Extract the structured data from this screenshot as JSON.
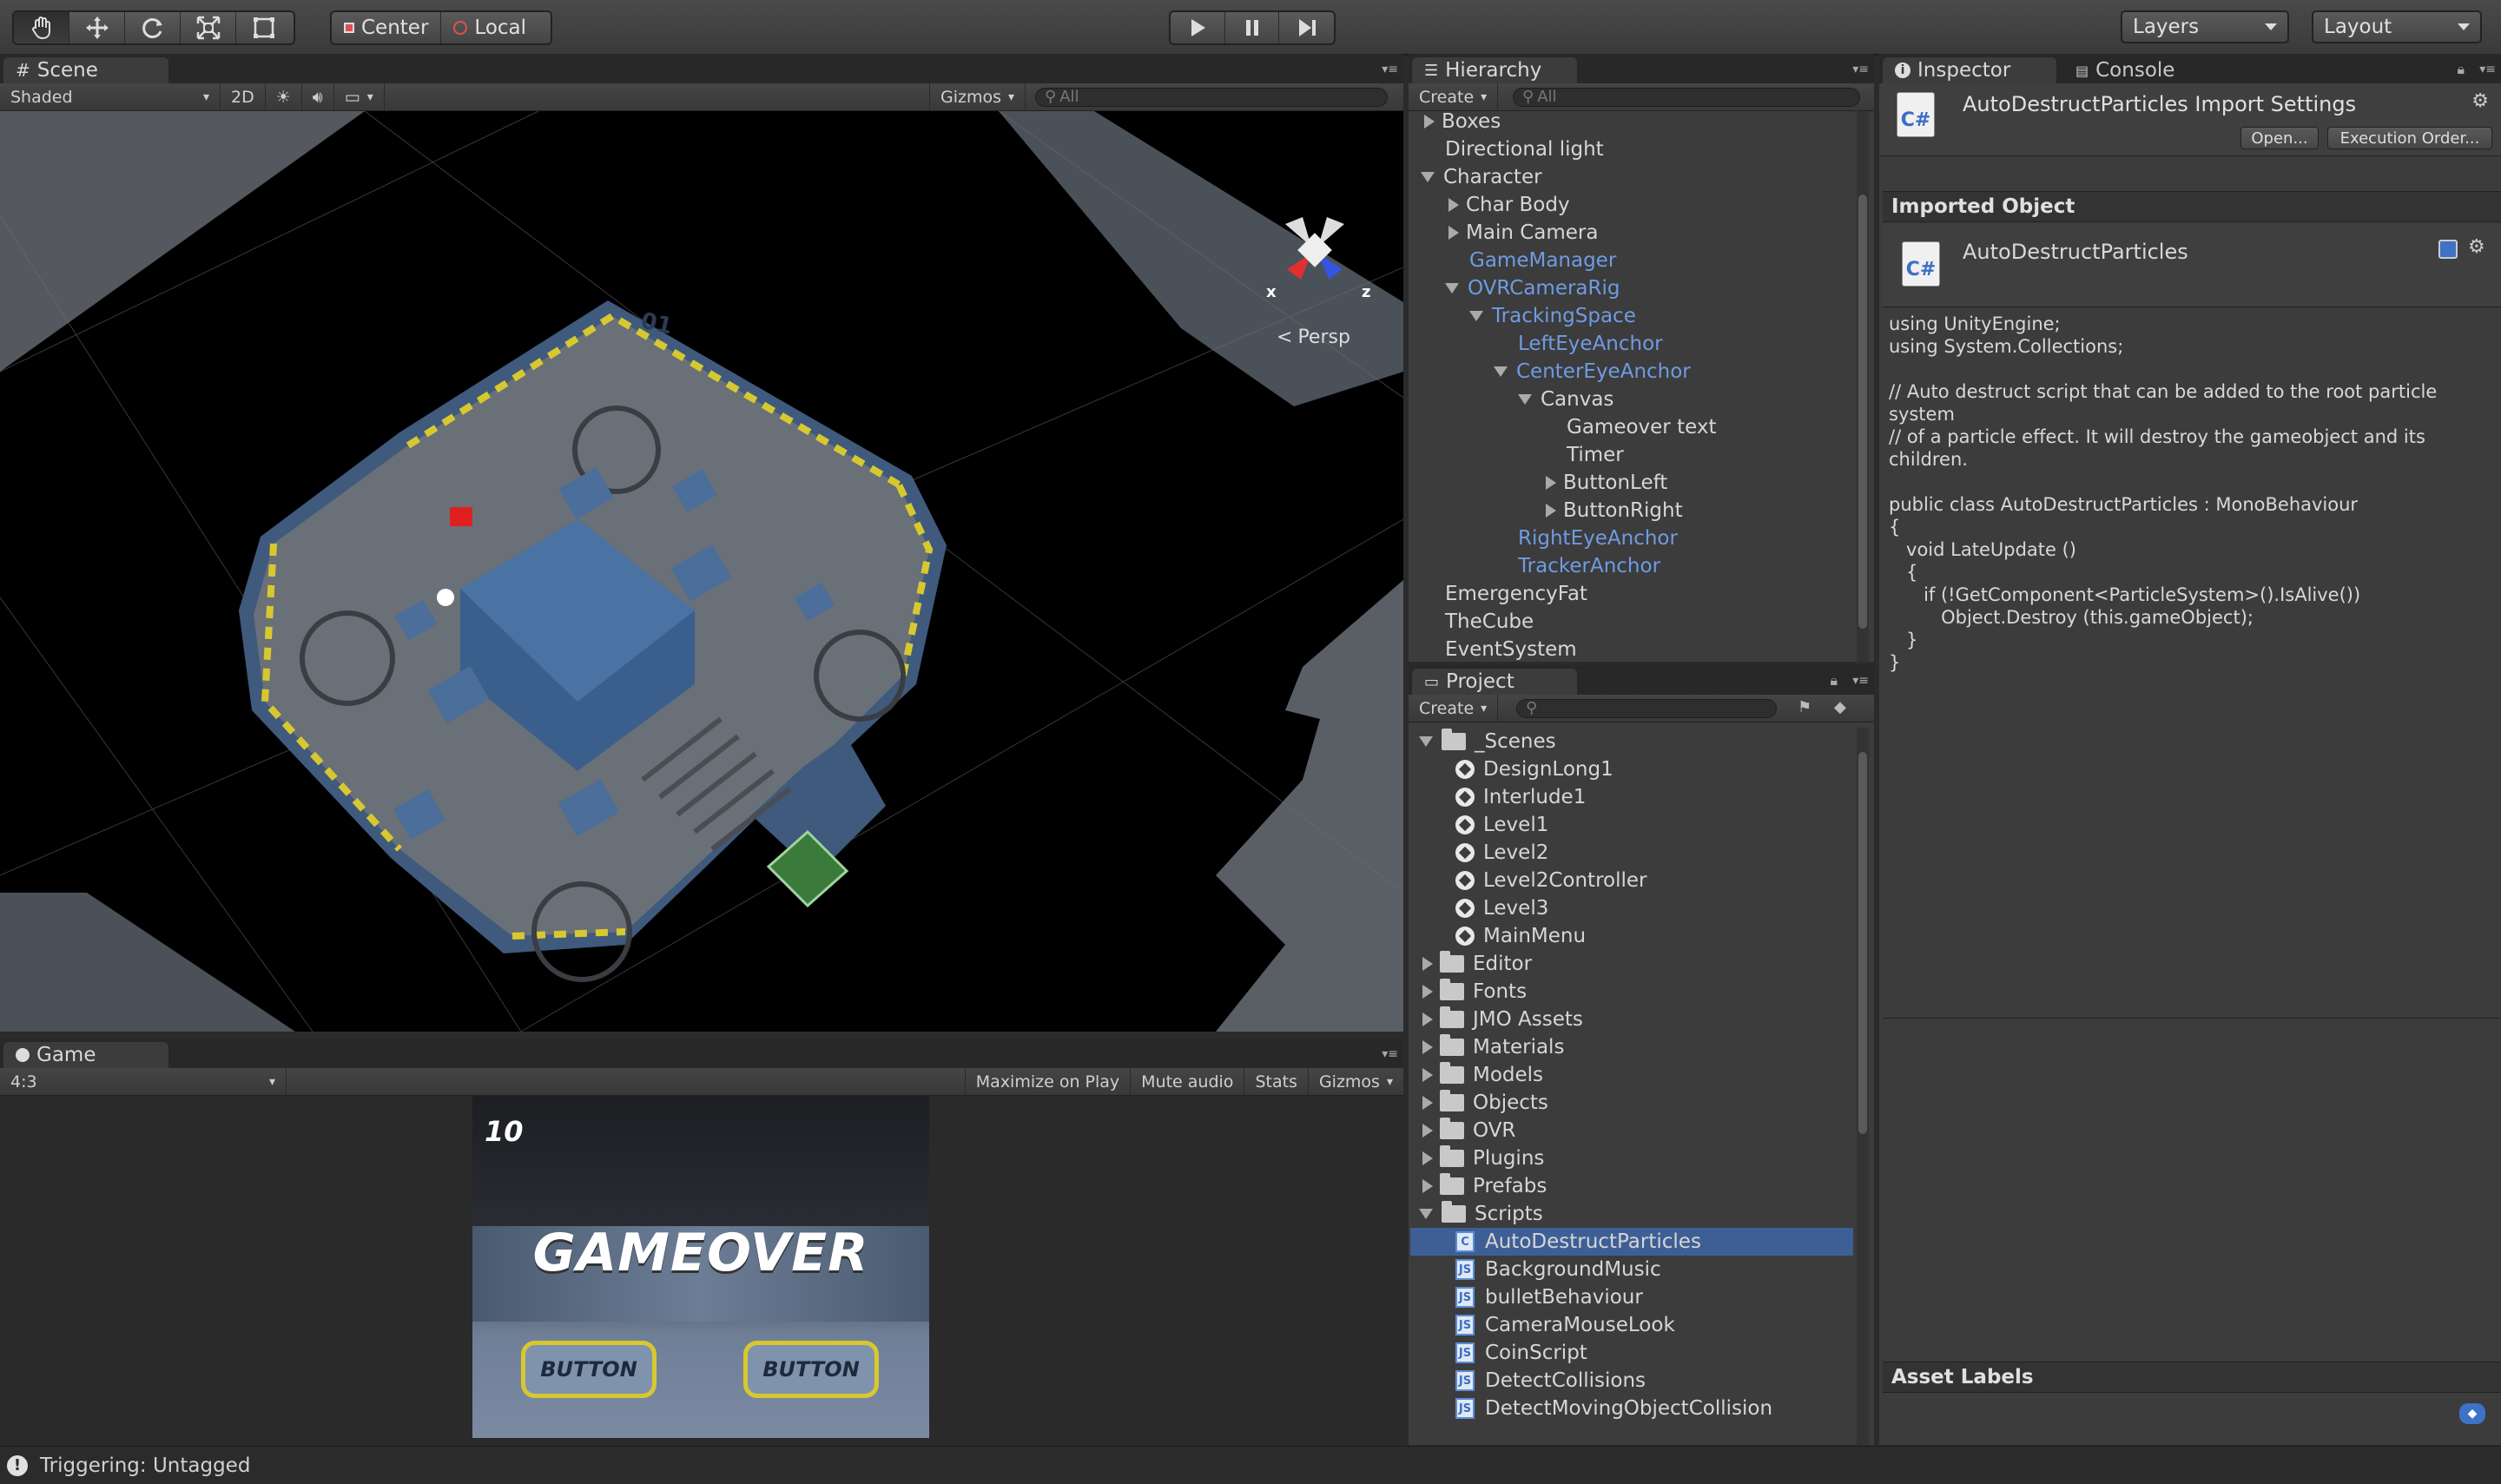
{
  "toolbar": {
    "pivot_center": "Center",
    "pivot_local": "Local",
    "layers_label": "Layers",
    "layout_label": "Layout"
  },
  "scene": {
    "tab_label": "Scene",
    "shading_mode": "Shaded",
    "mode_2d": "2D",
    "gizmos_label": "Gizmos",
    "search_placeholder": "All",
    "gizmo_x": "x",
    "gizmo_z": "z",
    "projection_label": "Persp",
    "room_number": "01"
  },
  "game": {
    "tab_label": "Game",
    "aspect": "4:3",
    "maximize_label": "Maximize on Play",
    "mute_label": "Mute audio",
    "stats_label": "Stats",
    "gizmos_label": "Gizmos",
    "timer_value": "10",
    "gameover_text": "GAMEOVER",
    "button_left": "BUTTON",
    "button_right": "BUTTON"
  },
  "hierarchy": {
    "tab_label": "Hierarchy",
    "create_label": "Create",
    "search_placeholder": "All",
    "items": [
      {
        "label": "Boxes",
        "indent": 0,
        "arrow": "closed",
        "blue": false
      },
      {
        "label": "Directional light",
        "indent": 0,
        "arrow": "none",
        "blue": false
      },
      {
        "label": "Character",
        "indent": 0,
        "arrow": "open",
        "blue": false
      },
      {
        "label": "Char Body",
        "indent": 1,
        "arrow": "closed",
        "blue": false
      },
      {
        "label": "Main Camera",
        "indent": 1,
        "arrow": "closed",
        "blue": false
      },
      {
        "label": "GameManager",
        "indent": 1,
        "arrow": "none",
        "blue": true
      },
      {
        "label": "OVRCameraRig",
        "indent": 1,
        "arrow": "open",
        "blue": true
      },
      {
        "label": "TrackingSpace",
        "indent": 2,
        "arrow": "open",
        "blue": true
      },
      {
        "label": "LeftEyeAnchor",
        "indent": 3,
        "arrow": "none",
        "blue": true
      },
      {
        "label": "CenterEyeAnchor",
        "indent": 3,
        "arrow": "open",
        "blue": true
      },
      {
        "label": "Canvas",
        "indent": 4,
        "arrow": "open",
        "blue": false
      },
      {
        "label": "Gameover text",
        "indent": 5,
        "arrow": "none",
        "blue": false
      },
      {
        "label": "Timer",
        "indent": 5,
        "arrow": "none",
        "blue": false
      },
      {
        "label": "ButtonLeft",
        "indent": 5,
        "arrow": "closed",
        "blue": false
      },
      {
        "label": "ButtonRight",
        "indent": 5,
        "arrow": "closed",
        "blue": false
      },
      {
        "label": "RightEyeAnchor",
        "indent": 3,
        "arrow": "none",
        "blue": true
      },
      {
        "label": "TrackerAnchor",
        "indent": 3,
        "arrow": "none",
        "blue": true
      },
      {
        "label": "EmergencyFat",
        "indent": 0,
        "arrow": "none",
        "blue": false
      },
      {
        "label": "TheCube",
        "indent": 0,
        "arrow": "none",
        "blue": false
      },
      {
        "label": "EventSystem",
        "indent": 0,
        "arrow": "none",
        "blue": false
      }
    ]
  },
  "project": {
    "tab_label": "Project",
    "create_label": "Create",
    "items": [
      {
        "label": "_Scenes",
        "indent": 0,
        "arrow": "open",
        "icon": "folder"
      },
      {
        "label": "DesignLong1",
        "indent": 1,
        "arrow": "none",
        "icon": "scene"
      },
      {
        "label": "Interlude1",
        "indent": 1,
        "arrow": "none",
        "icon": "scene"
      },
      {
        "label": "Level1",
        "indent": 1,
        "arrow": "none",
        "icon": "scene"
      },
      {
        "label": "Level2",
        "indent": 1,
        "arrow": "none",
        "icon": "scene"
      },
      {
        "label": "Level2Controller",
        "indent": 1,
        "arrow": "none",
        "icon": "scene"
      },
      {
        "label": "Level3",
        "indent": 1,
        "arrow": "none",
        "icon": "scene"
      },
      {
        "label": "MainMenu",
        "indent": 1,
        "arrow": "none",
        "icon": "scene"
      },
      {
        "label": "Editor",
        "indent": 0,
        "arrow": "closed",
        "icon": "folder"
      },
      {
        "label": "Fonts",
        "indent": 0,
        "arrow": "closed",
        "icon": "folder"
      },
      {
        "label": "JMO Assets",
        "indent": 0,
        "arrow": "closed",
        "icon": "folder"
      },
      {
        "label": "Materials",
        "indent": 0,
        "arrow": "closed",
        "icon": "folder"
      },
      {
        "label": "Models",
        "indent": 0,
        "arrow": "closed",
        "icon": "folder"
      },
      {
        "label": "Objects",
        "indent": 0,
        "arrow": "closed",
        "icon": "folder"
      },
      {
        "label": "OVR",
        "indent": 0,
        "arrow": "closed",
        "icon": "folder"
      },
      {
        "label": "Plugins",
        "indent": 0,
        "arrow": "closed",
        "icon": "folder"
      },
      {
        "label": "Prefabs",
        "indent": 0,
        "arrow": "closed",
        "icon": "folder"
      },
      {
        "label": "Scripts",
        "indent": 0,
        "arrow": "open",
        "icon": "folder"
      },
      {
        "label": "AutoDestructParticles",
        "indent": 1,
        "arrow": "none",
        "icon": "cs",
        "selected": true
      },
      {
        "label": "BackgroundMusic",
        "indent": 1,
        "arrow": "none",
        "icon": "js"
      },
      {
        "label": "bulletBehaviour",
        "indent": 1,
        "arrow": "none",
        "icon": "js"
      },
      {
        "label": "CameraMouseLook",
        "indent": 1,
        "arrow": "none",
        "icon": "js"
      },
      {
        "label": "CoinScript",
        "indent": 1,
        "arrow": "none",
        "icon": "js"
      },
      {
        "label": "DetectCollisions",
        "indent": 1,
        "arrow": "none",
        "icon": "js"
      },
      {
        "label": "DetectMovingObjectCollision",
        "indent": 1,
        "arrow": "none",
        "icon": "js"
      }
    ]
  },
  "inspector": {
    "tab_label": "Inspector",
    "console_tab_label": "Console",
    "title": "AutoDestructParticles Import Settings",
    "open_button": "Open...",
    "execution_order_button": "Execution Order...",
    "imported_object_header": "Imported Object",
    "object_name": "AutoDestructParticles",
    "icon_text": "C#",
    "code": "using UnityEngine;\nusing System.Collections;\n\n// Auto destruct script that can be added to the root particle system\n// of a particle effect. It will destroy the gameobject and its children.\n\npublic class AutoDestructParticles : MonoBehaviour\n{\n   void LateUpdate ()\n   {\n      if (!GetComponent<ParticleSystem>().IsAlive())\n         Object.Destroy (this.gameObject);\n   }\n}",
    "asset_labels_header": "Asset Labels"
  },
  "status": {
    "message": "Triggering: Untagged"
  }
}
